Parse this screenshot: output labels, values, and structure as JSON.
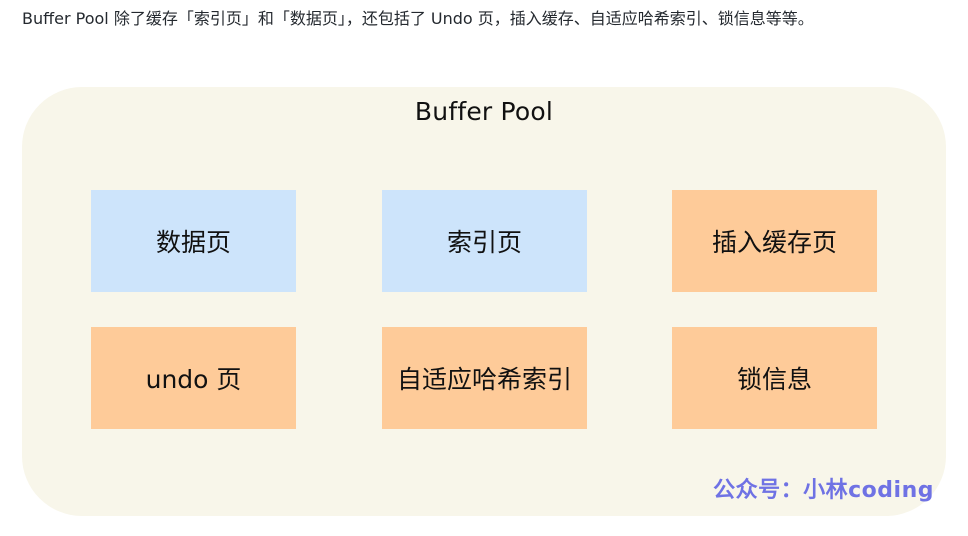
{
  "intro_text": "Buffer Pool 除了缓存「索引页」和「数据页」，还包括了 Undo 页，插入缓存、自适应哈希索引、锁信息等等。",
  "diagram": {
    "title": "Buffer Pool",
    "boxes": [
      {
        "label": "数据页",
        "color": "#cde4fb"
      },
      {
        "label": "索引页",
        "color": "#cde4fb"
      },
      {
        "label": "插入缓存页",
        "color": "#fecb99"
      },
      {
        "label": "undo 页",
        "color": "#fecb99"
      },
      {
        "label": "自适应哈希索引",
        "color": "#fecb99"
      },
      {
        "label": "锁信息",
        "color": "#fecb99"
      }
    ],
    "background_color": "#f8f6ea",
    "watermark": "公众号：小林coding",
    "watermark_color": "#6f72e4"
  }
}
